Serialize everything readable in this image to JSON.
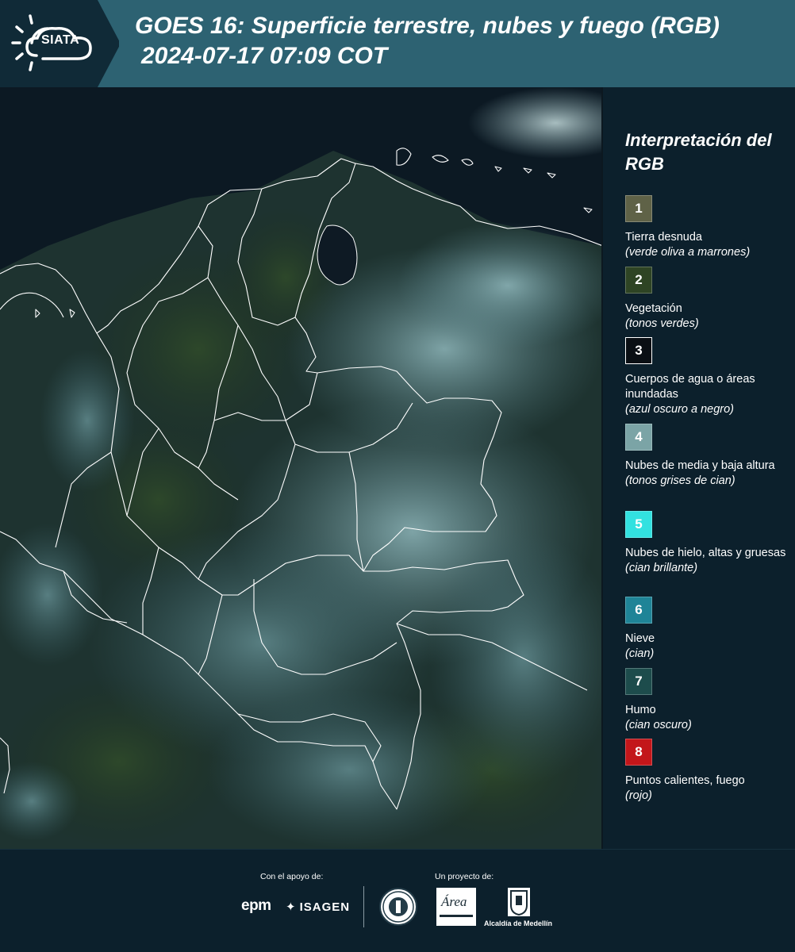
{
  "header": {
    "logo_text": "SIATA",
    "title_line1": "GOES 16: Superficie terrestre, nubes y fuego (RGB)",
    "title_line2": "2024-07-17 07:09 COT"
  },
  "legend": {
    "title": "Interpretación del RGB",
    "items": [
      {
        "number": "1",
        "label": "Tierra desnuda",
        "sub": "(verde oliva a marrones)",
        "color": "#5f6247"
      },
      {
        "number": "2",
        "label": "Vegetación",
        "sub": "(tonos verdes)",
        "color": "#2e4424"
      },
      {
        "number": "3",
        "label": "Cuerpos de agua o áreas inundadas",
        "sub": "(azul oscuro a negro)",
        "color": "#0a0f14"
      },
      {
        "number": "4",
        "label": "Nubes de media y baja altura",
        "sub": "(tonos grises de cian)",
        "color": "#7ba4a6"
      },
      {
        "number": "5",
        "label": "Nubes de hielo, altas y gruesas",
        "sub": "(cian brillante)",
        "color": "#32e1e0"
      },
      {
        "number": "6",
        "label": "Nieve",
        "sub": "(cian)",
        "color": "#1f8497"
      },
      {
        "number": "7",
        "label": "Humo",
        "sub": "(cian oscuro)",
        "color": "#1d4c4c"
      },
      {
        "number": "8",
        "label": "Puntos calientes, fuego",
        "sub": "(rojo)",
        "color": "#c3161a"
      }
    ]
  },
  "footer": {
    "support_label": "Con el apoyo de:",
    "project_label": "Un proyecto de:",
    "sponsor1": "epm",
    "sponsor2": "ISAGEN",
    "partner_area": "Área",
    "partner_alcaldia": "Alcaldía de Medellín"
  },
  "colors": {
    "header_bg": "#2d6272",
    "page_bg": "#0c202c",
    "boundary": "#ffffff"
  }
}
